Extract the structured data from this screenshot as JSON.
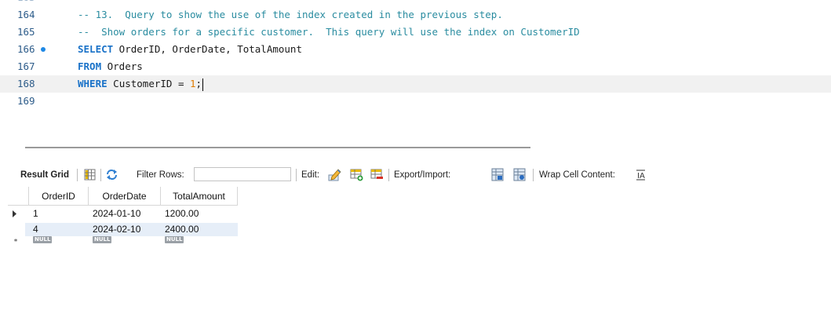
{
  "editor": {
    "lines": [
      {
        "num": "164",
        "breakpoint": false,
        "current": false,
        "tokens": [
          {
            "t": "comment",
            "v": "-- 13.  Query to show the use of the index created in the previous step."
          }
        ]
      },
      {
        "num": "165",
        "breakpoint": false,
        "current": false,
        "tokens": [
          {
            "t": "comment",
            "v": "--  Show orders for a specific customer.  This query will use the index on CustomerID"
          }
        ]
      },
      {
        "num": "166",
        "breakpoint": true,
        "current": false,
        "tokens": [
          {
            "t": "kw",
            "v": "SELECT"
          },
          {
            "t": "text",
            "v": " OrderID, OrderDate, TotalAmount"
          }
        ]
      },
      {
        "num": "167",
        "breakpoint": false,
        "current": false,
        "tokens": [
          {
            "t": "kw",
            "v": "FROM"
          },
          {
            "t": "text",
            "v": " Orders"
          }
        ]
      },
      {
        "num": "168",
        "breakpoint": false,
        "current": true,
        "tokens": [
          {
            "t": "kw",
            "v": "WHERE"
          },
          {
            "t": "text",
            "v": " CustomerID = "
          },
          {
            "t": "num",
            "v": "1"
          },
          {
            "t": "text",
            "v": ";"
          }
        ]
      },
      {
        "num": "169",
        "breakpoint": false,
        "current": false,
        "tokens": []
      }
    ]
  },
  "toolbar": {
    "result_grid_label": "Result Grid",
    "filter_rows_label": "Filter Rows:",
    "filter_value": "",
    "edit_label": "Edit:",
    "export_label": "Export/Import:",
    "wrap_label": "Wrap Cell Content:"
  },
  "grid": {
    "columns": [
      "OrderID",
      "OrderDate",
      "TotalAmount"
    ],
    "rows": [
      {
        "order_id": "1",
        "order_date": "2024-01-10",
        "total_amount": "1200.00"
      },
      {
        "order_id": "4",
        "order_date": "2024-02-10",
        "total_amount": "2400.00"
      }
    ],
    "null_label": "NULL"
  },
  "icons": {
    "grid_icon": "grid-layout-icon",
    "refresh_icon": "refresh-arrows-icon",
    "edit_icon": "pencil-edit-icon",
    "add_row_icon": "add-row-icon",
    "delete_row_icon": "delete-row-icon",
    "export_icon": "export-icon",
    "import_icon": "import-icon",
    "wrap_icon": "wrap-cell-icon"
  },
  "colors": {
    "comment": "#2a8ca0",
    "keyword": "#1a72c8",
    "number": "#e07b00",
    "breakpoint": "#1e88e5",
    "alt_row": "#e6eef8"
  }
}
